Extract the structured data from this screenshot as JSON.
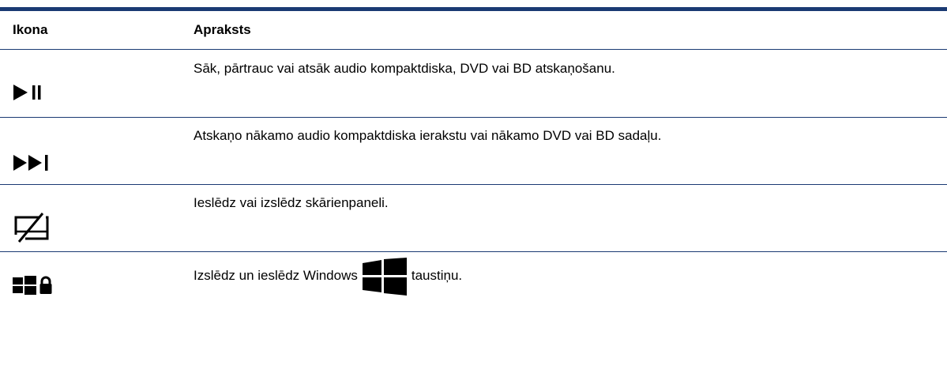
{
  "table": {
    "headers": {
      "icon": "Ikona",
      "description": "Apraksts"
    },
    "rows": [
      {
        "icon": "play-pause-icon",
        "description": "Sāk, pārtrauc vai atsāk audio kompaktdiska, DVD vai BD atskaņošanu."
      },
      {
        "icon": "next-track-icon",
        "description": "Atskaņo nākamo audio kompaktdiska ierakstu vai nākamo DVD vai BD sadaļu."
      },
      {
        "icon": "touchpad-toggle-icon",
        "description": "Ieslēdz vai izslēdz skārienpaneli."
      },
      {
        "icon": "windows-lock-icon",
        "description_before": "Izslēdz un ieslēdz Windows",
        "inline_icon": "windows-logo-icon",
        "description_after": "taustiņu."
      }
    ]
  },
  "colors": {
    "rule": "#1a3a73",
    "text": "#000000",
    "background": "#ffffff"
  }
}
